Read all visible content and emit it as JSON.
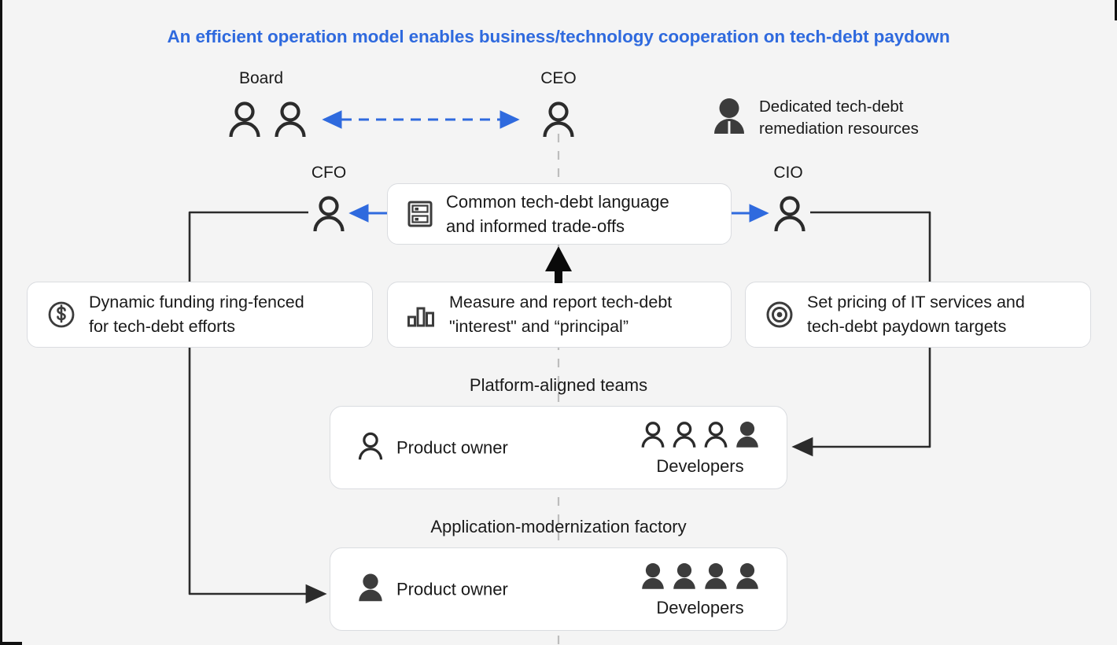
{
  "title": "An efficient operation model enables business/technology cooperation on tech-debt paydown",
  "colors": {
    "title_blue": "#2f6ade",
    "arrow_blue": "#2f6ade",
    "connector_black": "#2b2b2b",
    "dashed_gray": "#bdbdbd",
    "background": "#f4f4f4",
    "card_background": "#ffffff",
    "card_border": "#dadce0",
    "icon_dark": "#3c3c3c"
  },
  "roles": {
    "board": "Board",
    "ceo": "CEO",
    "cfo": "CFO",
    "cio": "CIO"
  },
  "legend": {
    "icon": "person-filled-icon",
    "text": "Dedicated tech-debt\nremediation resources"
  },
  "cards": {
    "center": {
      "icon": "server-rack-icon",
      "text": "Common tech-debt language\nand informed trade-offs"
    },
    "left": {
      "icon": "dollar-circle-icon",
      "text": "Dynamic funding ring-fenced\nfor tech-debt efforts"
    },
    "middle": {
      "icon": "bar-chart-icon",
      "text": "Measure and report tech-debt\n\"interest\" and “principal”"
    },
    "right": {
      "icon": "target-icon",
      "text": "Set pricing of IT services and\ntech-debt paydown targets"
    }
  },
  "teams": [
    {
      "caption": "Platform-aligned teams",
      "owner_label": "Product owner",
      "owner_icon": "person-outline-icon",
      "devs_label": "Developers",
      "dev_icons": [
        "person-outline-icon",
        "person-outline-icon",
        "person-outline-icon",
        "person-filled-icon"
      ]
    },
    {
      "caption": "Application-modernization factory",
      "owner_label": "Product owner",
      "owner_icon": "person-filled-icon",
      "devs_label": "Developers",
      "dev_icons": [
        "person-filled-icon",
        "person-filled-icon",
        "person-filled-icon",
        "person-filled-icon"
      ]
    }
  ],
  "people": {
    "board_icons": [
      "person-outline-icon",
      "person-outline-icon"
    ],
    "ceo_icons": [
      "person-outline-icon"
    ],
    "cfo_icons": [
      "person-outline-icon"
    ],
    "cio_icons": [
      "person-outline-icon"
    ]
  },
  "connectors": {
    "board_ceo": "dashed-double-arrow-blue",
    "center_to_cfo": "arrow-left-blue",
    "center_to_cio": "arrow-right-blue",
    "measure_to_center": "arrow-up-black",
    "ceo_vertical": "dashed-line-gray",
    "cfo_to_factory": "elbow-arrow-black",
    "cio_to_platform": "elbow-arrow-black"
  }
}
